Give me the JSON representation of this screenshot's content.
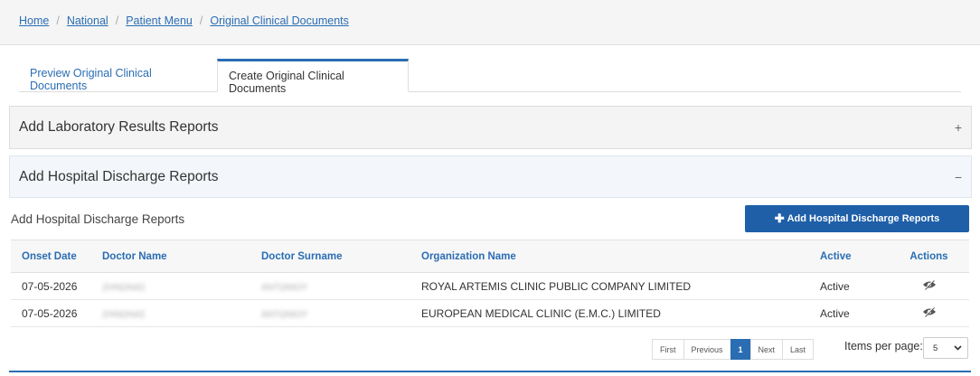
{
  "breadcrumb": [
    "Home",
    "National",
    "Patient Menu",
    "Original Clinical Documents"
  ],
  "tabs": [
    {
      "label": "Preview Original Clinical Documents"
    },
    {
      "label": "Create Original Clinical Documents"
    }
  ],
  "panels": {
    "lab": {
      "title": "Add Laboratory Results Reports",
      "toggle": "+"
    },
    "discharge": {
      "title": "Add Hospital Discharge Reports",
      "toggle": "−"
    }
  },
  "section": {
    "title": "Add Hospital Discharge Reports",
    "add_button": "Add Hospital Discharge Reports"
  },
  "table": {
    "headers": [
      "Onset Date",
      "Doctor Name",
      "Doctor Surname",
      "Organization Name",
      "Active",
      "Actions"
    ],
    "rows": [
      {
        "onset": "07-05-2026",
        "doctor_name": "ΖΗΝΩΝΑΣ",
        "doctor_surname": "ΑΝΤΩΝΙΟΥ",
        "organization": "ROYAL ARTEMIS CLINIC PUBLIC COMPANY LIMITED",
        "active": "Active"
      },
      {
        "onset": "07-05-2026",
        "doctor_name": "ΖΗΝΩΝΑΣ",
        "doctor_surname": "ΑΝΤΩΝΙΟΥ",
        "organization": "EUROPEAN MEDICAL CLINIC (E.M.C.) LIMITED",
        "active": "Active"
      }
    ]
  },
  "pager": {
    "first": "First",
    "previous": "Previous",
    "current": "1",
    "next": "Next",
    "last": "Last"
  },
  "items_per_page": {
    "label": "Items per page:",
    "value": "5"
  },
  "colors": {
    "accent": "#2a6db3",
    "button": "#1e5fa8"
  }
}
